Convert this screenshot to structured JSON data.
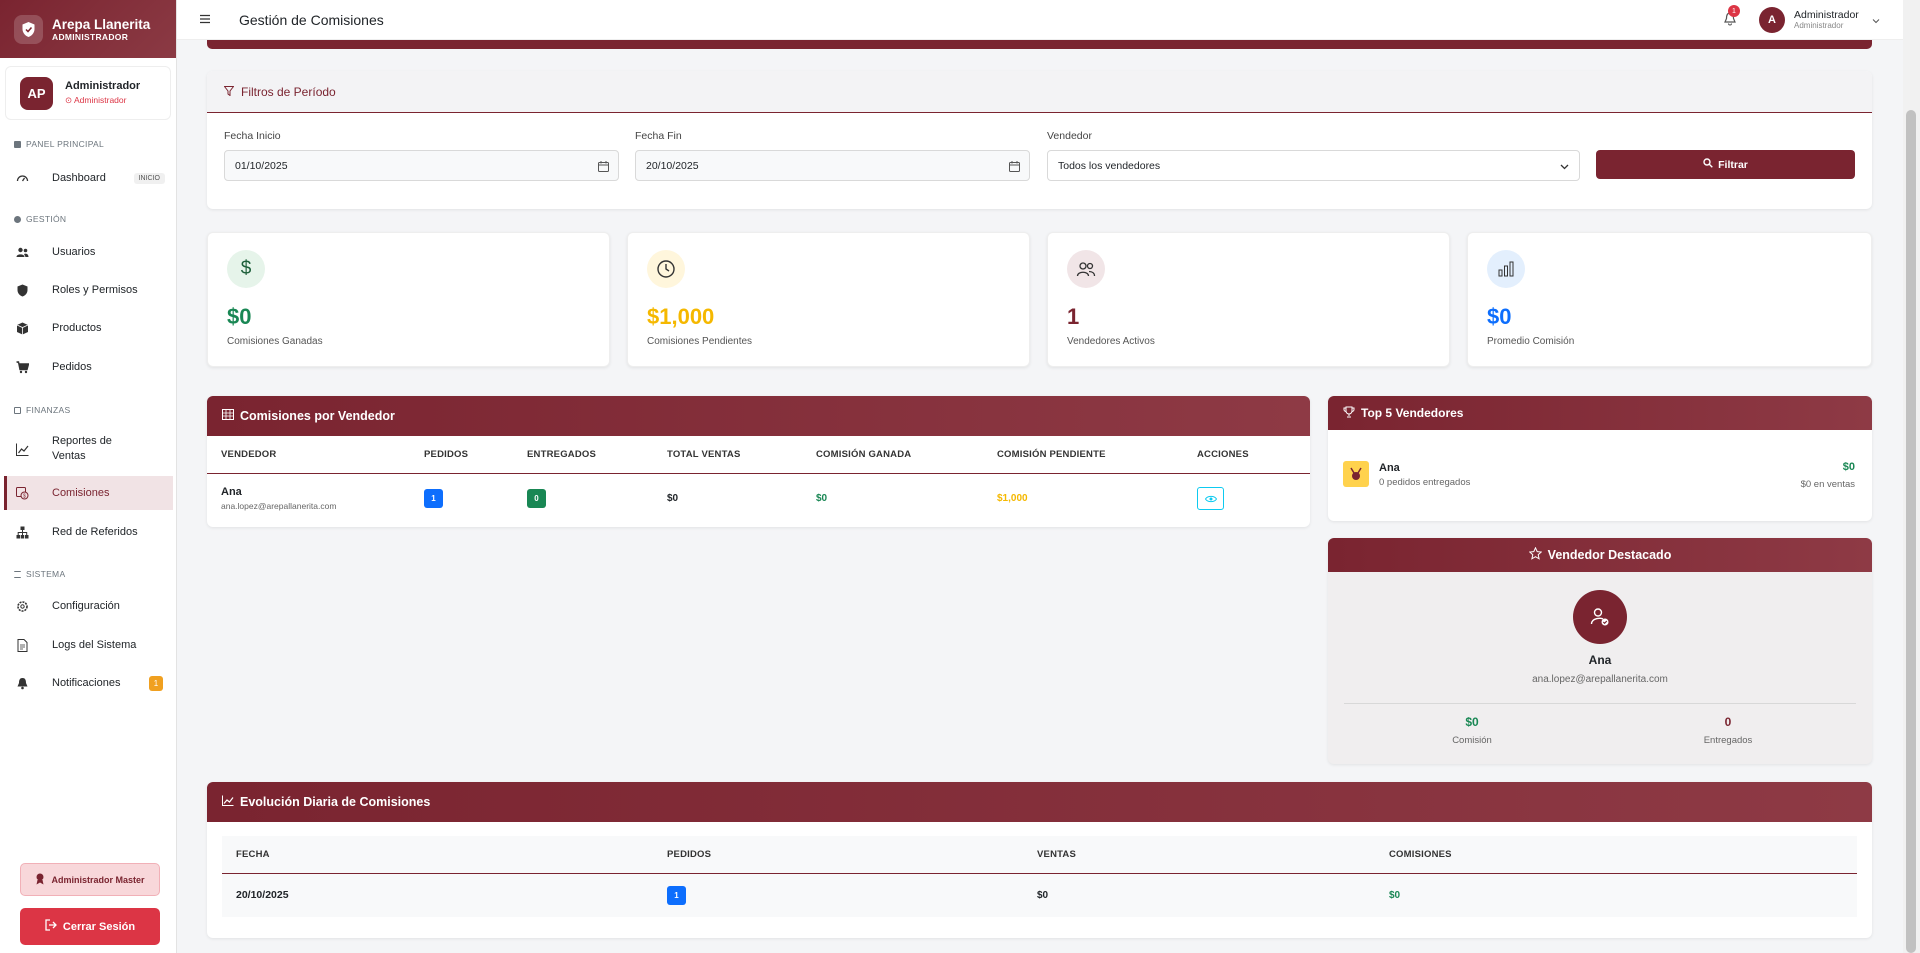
{
  "brand": {
    "title": "Arepa Llanerita",
    "subtitle": "ADMINISTRADOR"
  },
  "user": {
    "initials": "AP",
    "name": "Administrador",
    "role": "Administrador"
  },
  "sidebar": {
    "sections": [
      {
        "label": "PANEL PRINCIPAL"
      },
      {
        "label": "GESTIÓN"
      },
      {
        "label": "FINANZAS"
      },
      {
        "label": "SISTEMA"
      }
    ],
    "items": [
      {
        "label": "Dashboard",
        "badge": "INICIO",
        "icon": "dashboard-icon"
      },
      {
        "label": "Usuarios",
        "icon": "users-icon"
      },
      {
        "label": "Roles y Permisos",
        "icon": "shield-icon"
      },
      {
        "label": "Productos",
        "icon": "box-icon"
      },
      {
        "label": "Pedidos",
        "icon": "cart-icon"
      },
      {
        "label": "Reportes de Ventas",
        "icon": "chart-line-icon"
      },
      {
        "label": "Comisiones",
        "icon": "commission-icon"
      },
      {
        "label": "Red de Referidos",
        "icon": "network-icon"
      },
      {
        "label": "Configuración",
        "icon": "gear-icon"
      },
      {
        "label": "Logs del Sistema",
        "icon": "file-icon"
      },
      {
        "label": "Notificaciones",
        "badge": "1",
        "icon": "bell-icon"
      }
    ],
    "master_label": "Administrador Master",
    "logout_label": "Cerrar Sesión"
  },
  "topbar": {
    "title": "Gestión de Comisiones",
    "notification_count": "1",
    "avatar_initial": "A",
    "user_name": "Administrador",
    "user_role": "Administrador"
  },
  "filters": {
    "title": "Filtros de Período",
    "start_label": "Fecha Inicio",
    "start_value": "01/10/2025",
    "end_label": "Fecha Fin",
    "end_value": "20/10/2025",
    "seller_label": "Vendedor",
    "seller_value": "Todos los vendedores",
    "button_label": "Filtrar"
  },
  "stats": [
    {
      "value": "$0",
      "label": "Comisiones Ganadas",
      "color": "#198754",
      "icon": "dollar-icon"
    },
    {
      "value": "$1,000",
      "label": "Comisiones Pendientes",
      "color": "#f5b800",
      "icon": "clock-icon"
    },
    {
      "value": "1",
      "label": "Vendedores Activos",
      "color": "#7a2430",
      "icon": "users-icon"
    },
    {
      "value": "$0",
      "label": "Promedio Comisión",
      "color": "#0d6efd",
      "icon": "bar-chart-icon"
    }
  ],
  "commissions_table": {
    "title": "Comisiones por Vendedor",
    "headers": [
      "VENDEDOR",
      "PEDIDOS",
      "ENTREGADOS",
      "TOTAL VENTAS",
      "COMISIÓN GANADA",
      "COMISIÓN PENDIENTE",
      "ACCIONES"
    ],
    "rows": [
      {
        "name": "Ana",
        "email": "ana.lopez@arepallanerita.com",
        "pedidos": "1",
        "entregados": "0",
        "total": "$0",
        "ganada": "$0",
        "pendiente": "$1,000"
      }
    ]
  },
  "top_sellers": {
    "title": "Top 5 Vendedores",
    "items": [
      {
        "name": "Ana",
        "detail": "0 pedidos entregados",
        "amount": "$0",
        "sales": "$0 en ventas"
      }
    ]
  },
  "featured": {
    "title": "Vendedor Destacado",
    "name": "Ana",
    "email": "ana.lopez@arepallanerita.com",
    "commission_value": "$0",
    "commission_label": "Comisión",
    "delivered_value": "0",
    "delivered_label": "Entregados"
  },
  "daily": {
    "title": "Evolución Diaria de Comisiones",
    "headers": [
      "FECHA",
      "PEDIDOS",
      "VENTAS",
      "COMISIONES"
    ],
    "rows": [
      {
        "fecha": "20/10/2025",
        "pedidos": "1",
        "ventas": "$0",
        "comisiones": "$0"
      }
    ]
  }
}
